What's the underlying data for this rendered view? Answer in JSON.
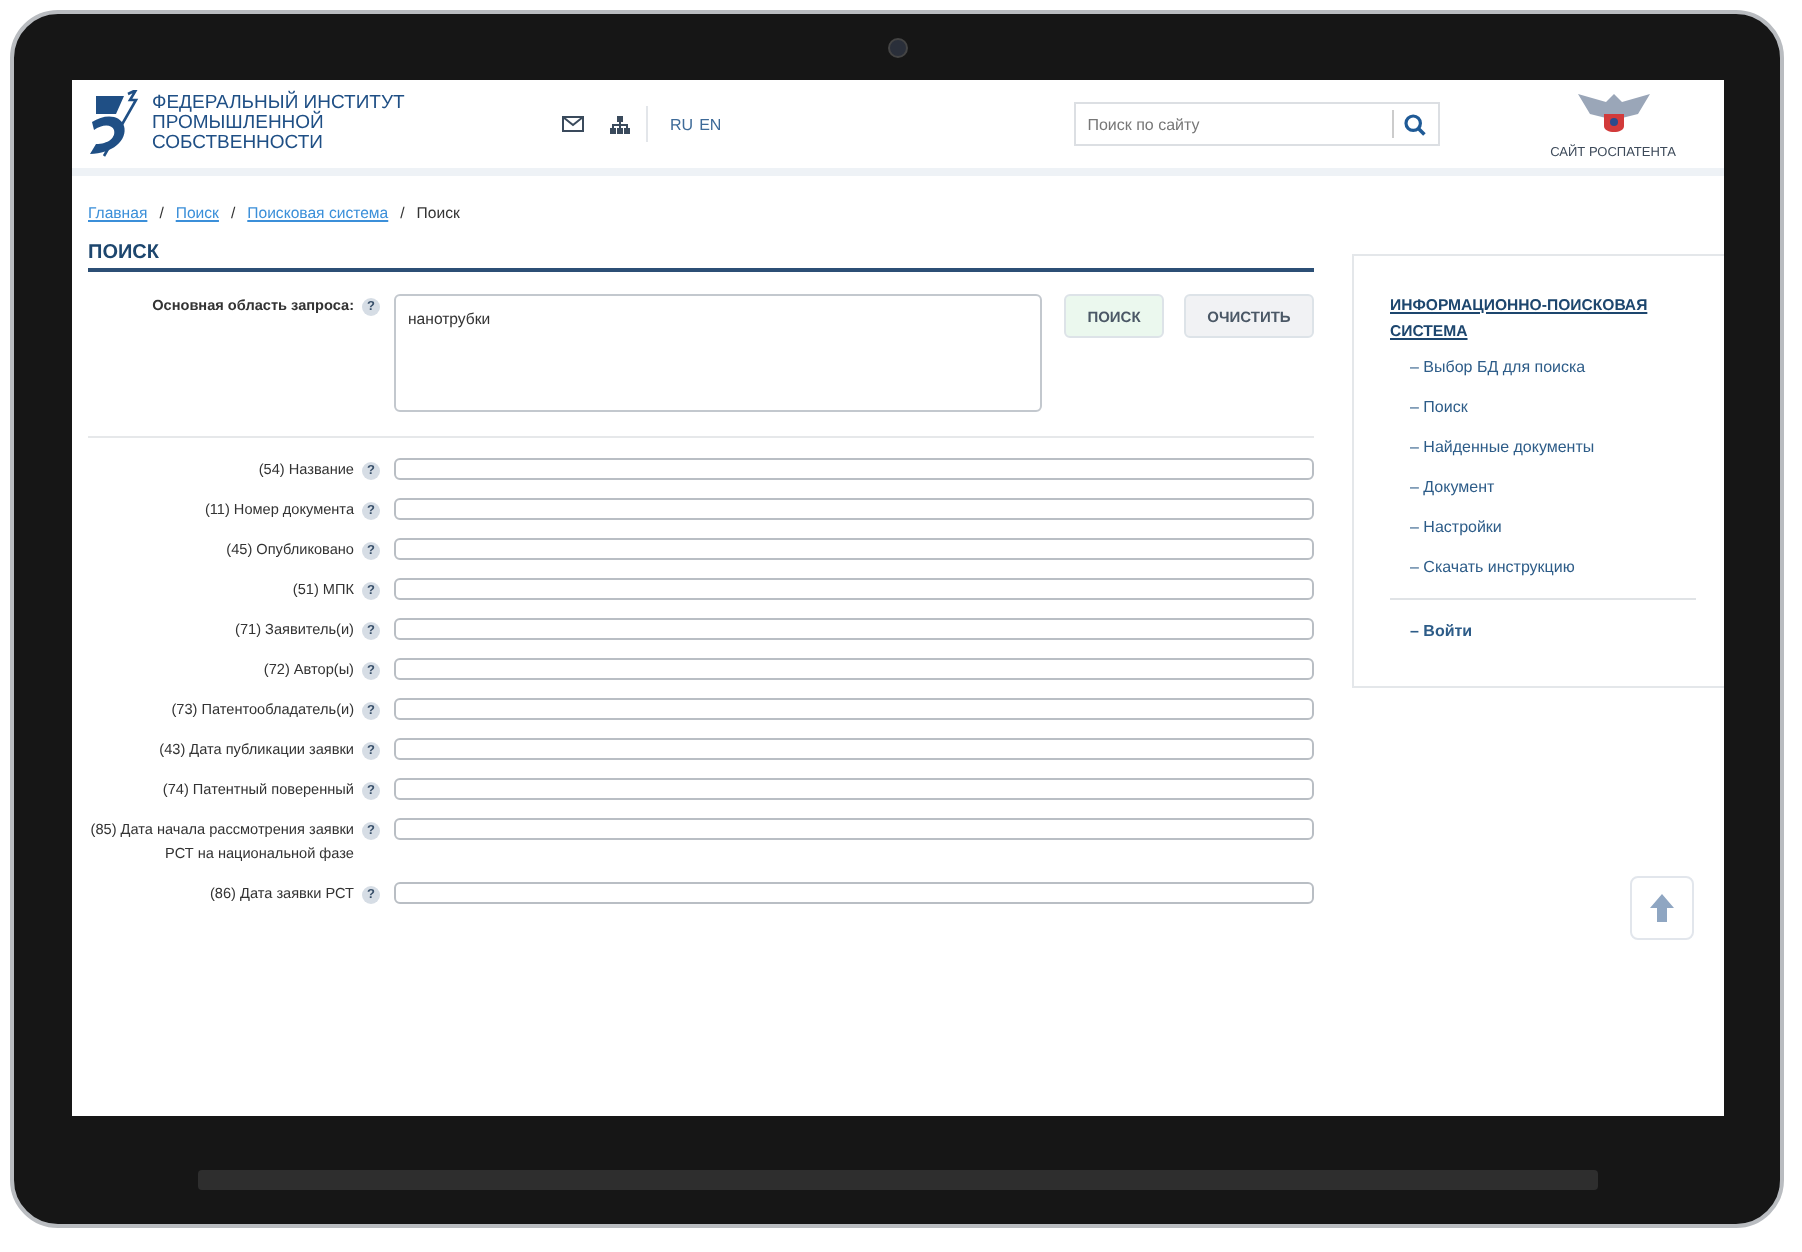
{
  "header": {
    "logo_text": "ФЕДЕРАЛЬНЫЙ ИНСТИТУТ\nПРОМЫШЛЕННОЙ\nСОБСТВЕННОСТИ",
    "languages": [
      "RU",
      "EN"
    ],
    "search": {
      "placeholder": "Поиск по сайту"
    },
    "partner_link": "САЙТ РОСПАТЕНТА"
  },
  "breadcrumb": [
    {
      "label": "Главная",
      "kind": "link"
    },
    {
      "separator": "/",
      "label": "Поиск",
      "kind": "link"
    },
    {
      "separator": "/",
      "label": "Поисковая система",
      "kind": "link"
    },
    {
      "separator": "/",
      "label": "Поиск",
      "kind": "current"
    }
  ],
  "title": "ПОИСК",
  "query": {
    "label": "Основная область запроса:",
    "help": "?",
    "value": "нанотрубки"
  },
  "buttons": [
    {
      "label": "ПОИСК",
      "kind": "primary"
    },
    {
      "label": "ОЧИСТИТЬ",
      "kind": "secondary"
    }
  ],
  "fields": [
    {
      "label": "(54) Название",
      "help": "?"
    },
    {
      "label": "(11) Номер документа",
      "help": "?"
    },
    {
      "label": "(45) Опубликовано",
      "help": "?"
    },
    {
      "label": "(51) МПК",
      "help": "?"
    },
    {
      "label": "(71) Заявитель(и)",
      "help": "?"
    },
    {
      "label": "(72) Автор(ы)",
      "help": "?"
    },
    {
      "label": "(73) Патентообладатель(и)",
      "help": "?"
    },
    {
      "label": "(43) Дата публикации заявки",
      "help": "?"
    },
    {
      "label": "(74) Патентный поверенный",
      "help": "?"
    },
    {
      "label": "(85) Дата начала рассмотрения заявки РСТ на национальной фазе",
      "help": "?"
    },
    {
      "label": "(86) Дата заявки РСТ",
      "help": "?"
    }
  ],
  "sidebar": {
    "title": "ИНФОРМАЦИОННО-ПОИСКОВАЯ СИСТЕМА",
    "items": [
      "– Выбор БД для поиска",
      "– Поиск",
      "– Найденные документы",
      "– Документ",
      "– Настройки",
      "– Скачать инструкцию"
    ],
    "login": "– Войти"
  }
}
